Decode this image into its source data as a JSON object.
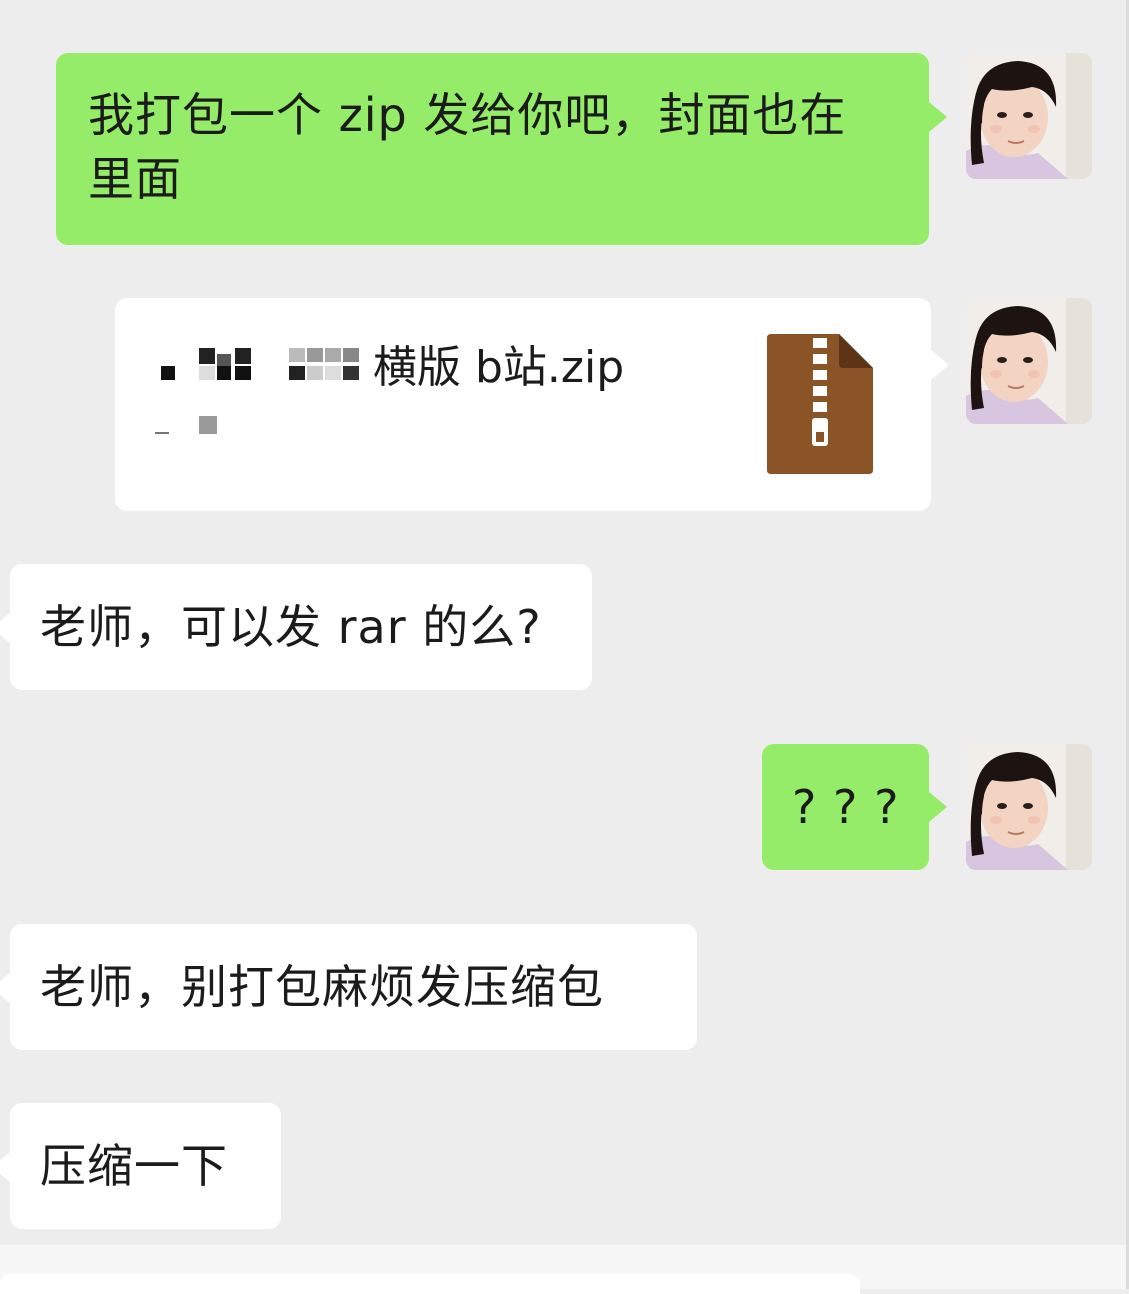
{
  "conversation": {
    "messages": [
      {
        "direction": "outgoing",
        "type": "text",
        "lines": [
          "我打包一个 zip 发给你吧，封面也在",
          "里面"
        ]
      },
      {
        "direction": "outgoing",
        "type": "file",
        "file_name": "横版 b站.zip",
        "file_icon": "zip-file-icon",
        "file_icon_color": "#8b5427"
      },
      {
        "direction": "incoming",
        "type": "text",
        "text": "老师，可以发 rar 的么?"
      },
      {
        "direction": "outgoing",
        "type": "text",
        "text": "? ? ?"
      },
      {
        "direction": "incoming",
        "type": "text",
        "text": "老师，别打包麻烦发压缩包"
      },
      {
        "direction": "incoming",
        "type": "text",
        "text": "压缩一下"
      }
    ]
  },
  "colors": {
    "background": "#ededed",
    "outgoing_bubble": "#95ec69",
    "incoming_bubble": "#ffffff",
    "text": "#1b1b1b"
  }
}
